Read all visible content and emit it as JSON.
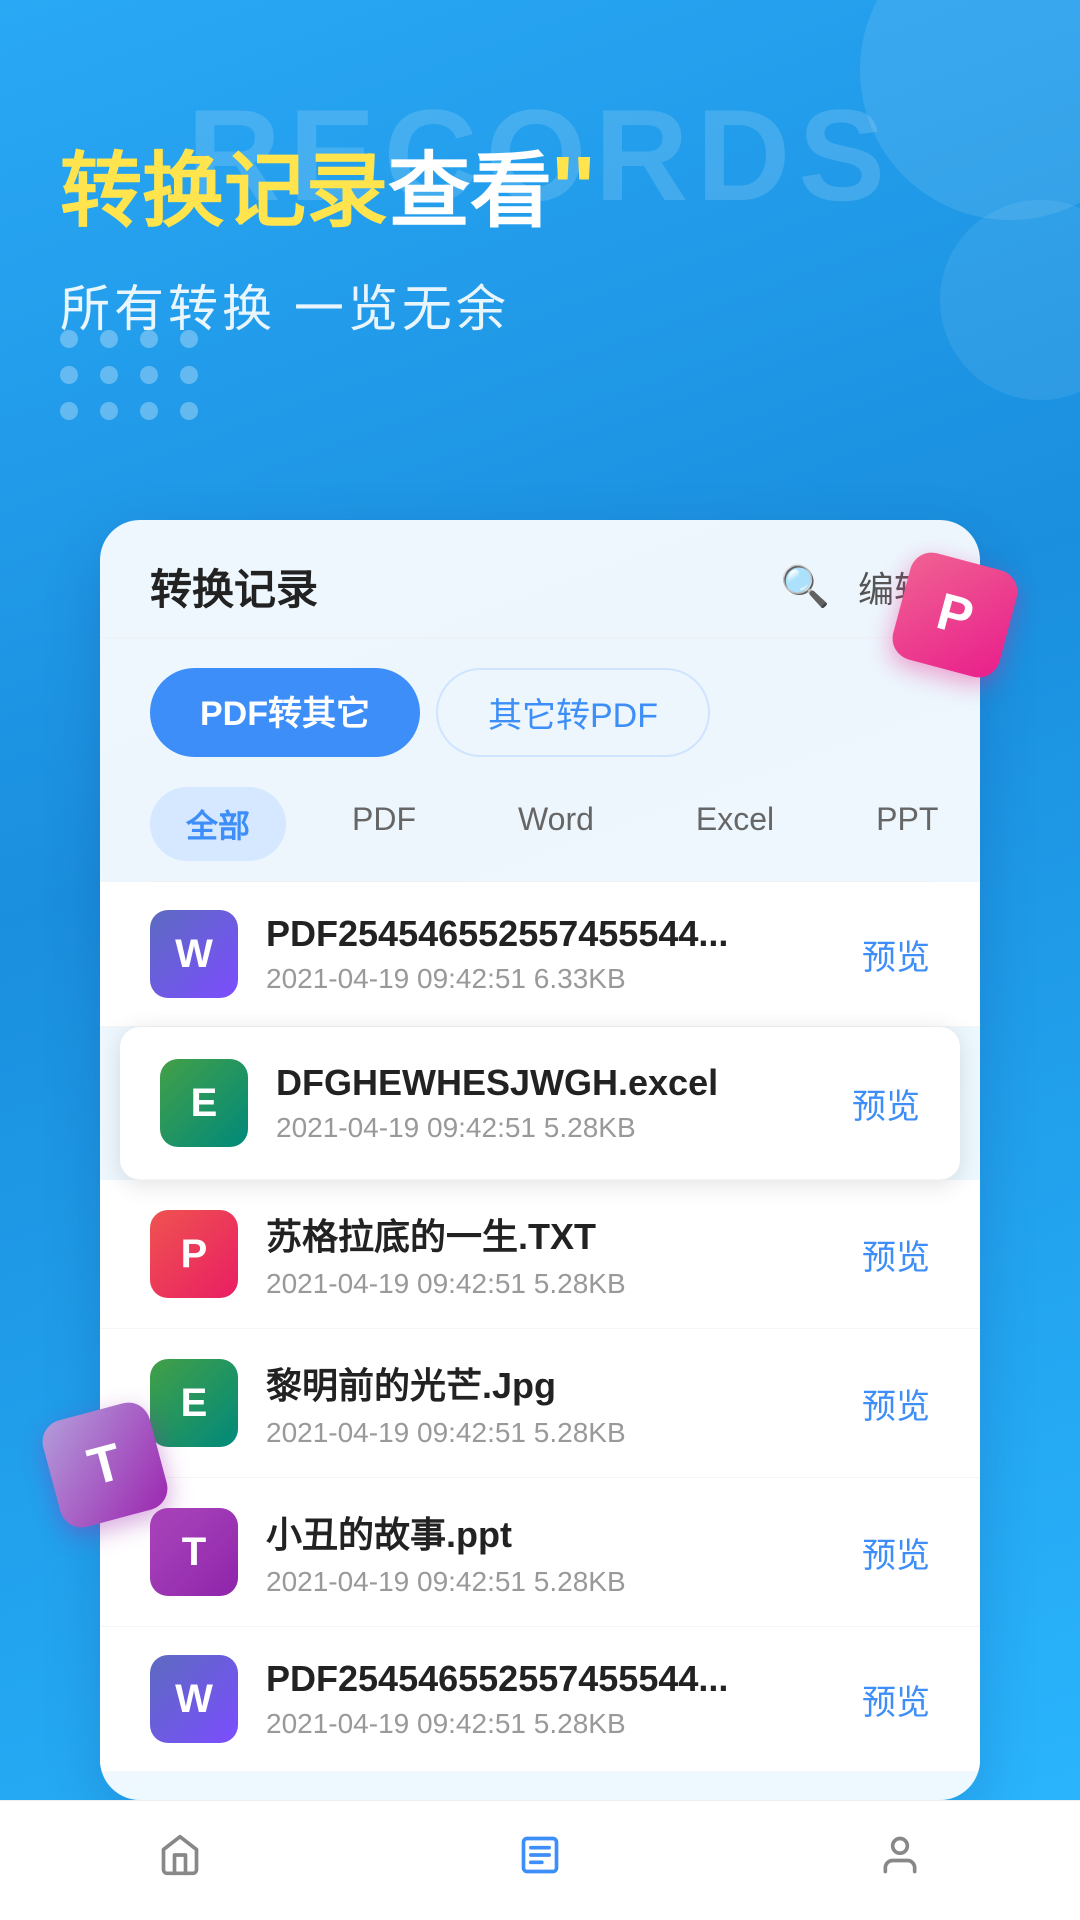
{
  "background": {
    "records_text": "RECORDS",
    "gradient_start": "#29a8f5",
    "gradient_end": "#1a8fde"
  },
  "hero": {
    "title_part1": "转换记录",
    "title_part2": "查看",
    "title_quotes": "''",
    "subtitle": "所有转换  一览无余"
  },
  "badges": {
    "p_label": "P",
    "t_label": "T"
  },
  "card": {
    "title": "转换记录",
    "search_label": "搜索",
    "edit_label": "编辑",
    "tabs": [
      {
        "label": "PDF转其它",
        "active": true
      },
      {
        "label": "其它转PDF",
        "active": false
      }
    ],
    "filters": [
      {
        "label": "全部",
        "active": true
      },
      {
        "label": "PDF",
        "active": false
      },
      {
        "label": "Word",
        "active": false
      },
      {
        "label": "Excel",
        "active": false
      },
      {
        "label": "PPT",
        "active": false
      }
    ],
    "files": [
      {
        "icon_letter": "W",
        "icon_type": "word",
        "name": "PDF254546552557455544...",
        "meta": "2021-04-19  09:42:51  6.33KB",
        "preview": "预览",
        "highlighted": false
      },
      {
        "icon_letter": "E",
        "icon_type": "excel",
        "name": "DFGHEWHESJWGH.excel",
        "meta": "2021-04-19  09:42:51  5.28KB",
        "preview": "预览",
        "highlighted": true
      },
      {
        "icon_letter": "P",
        "icon_type": "ppt",
        "name": "苏格拉底的一生.TXT",
        "meta": "2021-04-19  09:42:51  5.28KB",
        "preview": "预览",
        "highlighted": false
      },
      {
        "icon_letter": "E",
        "icon_type": "excel",
        "name": "黎明前的光芒.Jpg",
        "meta": "2021-04-19  09:42:51  5.28KB",
        "preview": "预览",
        "highlighted": false
      },
      {
        "icon_letter": "T",
        "icon_type": "txt",
        "name": "小丑的故事.ppt",
        "meta": "2021-04-19  09:42:51  5.28KB",
        "preview": "预览",
        "highlighted": false
      },
      {
        "icon_letter": "W",
        "icon_type": "word",
        "name": "PDF254546552557455544...",
        "meta": "2021-04-19  09:42:51  5.28KB",
        "preview": "预览",
        "highlighted": false
      }
    ]
  },
  "bottom_nav": {
    "items": [
      {
        "icon": "home",
        "label": "主页",
        "active": false
      },
      {
        "icon": "list",
        "label": "记录",
        "active": true
      },
      {
        "icon": "user",
        "label": "我的",
        "active": false
      }
    ]
  }
}
